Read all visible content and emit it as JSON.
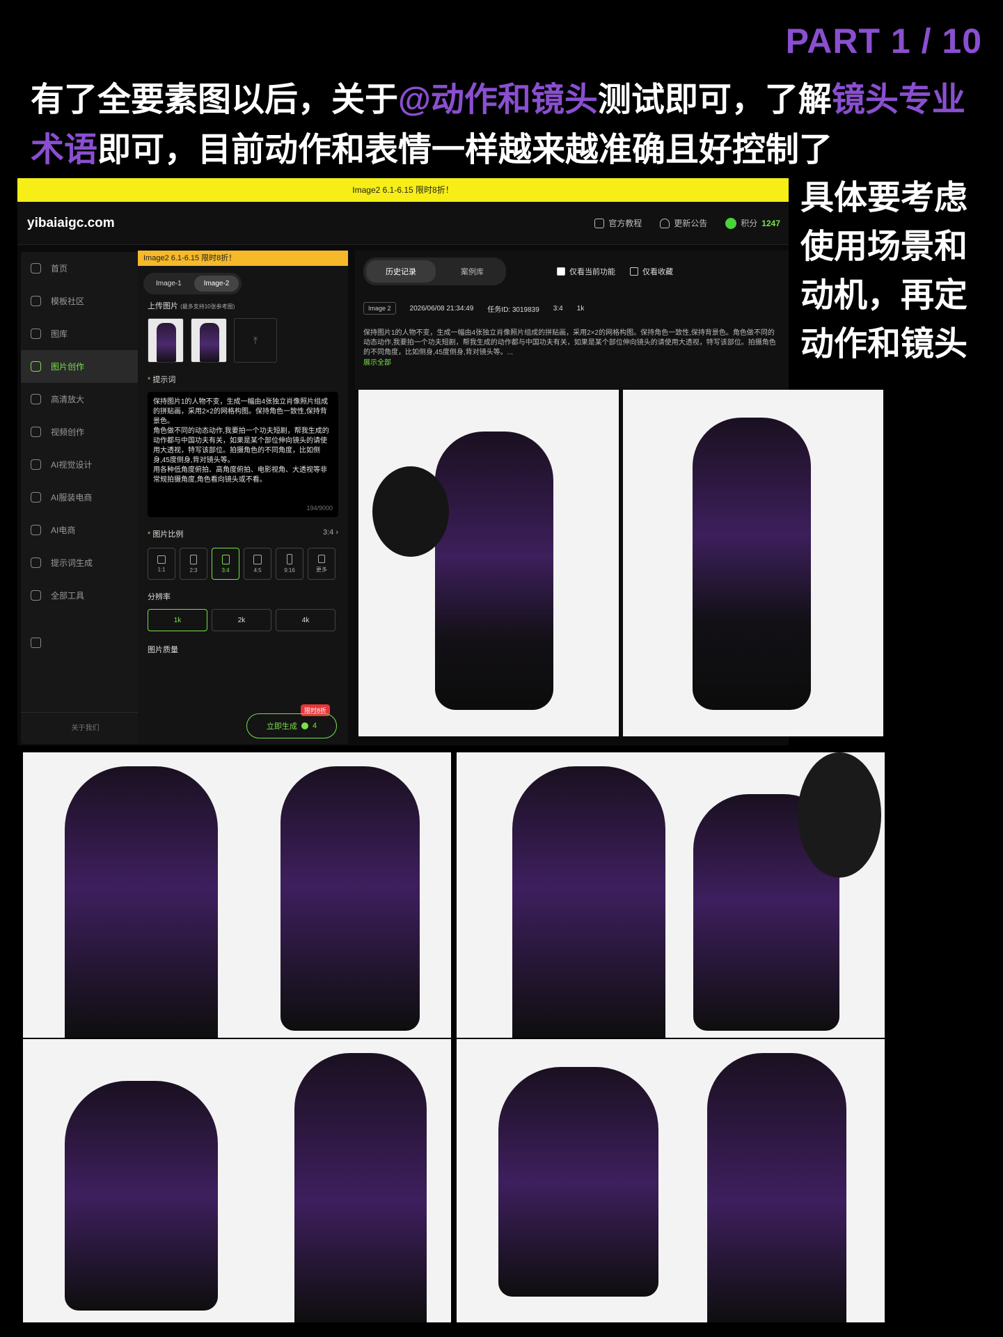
{
  "part_label": "PART 1 / 10",
  "headline": {
    "seg1": "有了全要素图以后，关于",
    "seg2": "@动作和镜头",
    "seg3": "测试即可，了解",
    "seg4": "镜头专业术语",
    "seg5": "即可，目前动作和表情一样越来越准确且好控制了"
  },
  "side_note": "具体要考虑使用场景和动机，再定动作和镜头",
  "colors": {
    "accent_purple": "#8a4fd0",
    "accent_green": "#7be04a",
    "promo_yellow": "#f6ee16"
  },
  "app": {
    "promo": "Image2 6.1-6.15 限时8折！",
    "logo": "yibaiaigc.com",
    "nav": {
      "tutorial": "官方教程",
      "announcement": "更新公告",
      "points_label": "积分",
      "points_value": "1247"
    },
    "sidebar": {
      "items": [
        {
          "label": "首页",
          "icon": "home-icon"
        },
        {
          "label": "模板社区",
          "icon": "community-icon"
        },
        {
          "label": "图库",
          "icon": "gallery-icon"
        },
        {
          "label": "图片创作",
          "icon": "image-create-icon"
        },
        {
          "label": "高清放大",
          "icon": "upscale-icon"
        },
        {
          "label": "视频创作",
          "icon": "video-icon"
        },
        {
          "label": "AI视觉设计",
          "icon": "design-icon"
        },
        {
          "label": "AI服装电商",
          "icon": "apparel-icon"
        },
        {
          "label": "AI电商",
          "icon": "ecommerce-icon"
        },
        {
          "label": "提示词生成",
          "icon": "prompt-icon"
        },
        {
          "label": "全部工具",
          "icon": "tools-icon"
        }
      ],
      "active_index": 3,
      "footer": "关于我们"
    },
    "panel": {
      "promo": "Image2 6.1-6.15 限时8折！",
      "model_tabs": [
        "Image-1",
        "Image-2"
      ],
      "active_model": 1,
      "upload_label": "上传图片",
      "upload_hint": "(最多支持10张参考图)",
      "upload_icon": "upload-icon",
      "prompt_label": "提示词",
      "prompt_text": "保持图片1的人物不变，生成一幅由4张独立肖像照片组成的拼贴画，采用2×2的网格构图。保持角色一致性,保持背景色。\n角色做不同的动态动作,我要拍一个功夫短剧，帮我生成的动作都与中国功夫有关，如果是某个部位伸向镜头的请使用大透视，特写该部位。拍摄角色的不同角度，比如侧身,45度侧身,背对镜头等。\n用各种低角度俯拍、高角度俯拍、电影视角、大透视等非常规拍摄角度,角色看向镜头或不看。",
      "prompt_count": "194/9000",
      "ratio_label": "图片比例",
      "ratio_value": "3:4",
      "ratios": [
        "1:1",
        "2:3",
        "3:4",
        "4:5",
        "9:16",
        "更多"
      ],
      "active_ratio": 2,
      "resolution_label": "分辨率",
      "resolutions": [
        "1k",
        "2k",
        "4k"
      ],
      "active_resolution": 0,
      "quality_label": "图片质量",
      "generate_tag": "限时8折",
      "generate_label": "立即生成",
      "generate_cost": "4"
    },
    "history": {
      "tabs": [
        "历史记录",
        "案例库"
      ],
      "active_tab": 0,
      "filter1": "仅看当前功能",
      "filter2": "仅看收藏",
      "model_badge": "Image 2",
      "timestamp": "2026/06/08 21:34:49",
      "task_id": "任务ID: 3019839",
      "ratio": "3:4",
      "resolution": "1k",
      "description": "保持图片1的人物不变，生成一幅由4张独立肖像照片组成的拼贴画，采用2×2的网格构图。保持角色一致性,保持背景色。角色做不同的动态动作,我要拍一个功夫短剧，帮我生成的动作都与中国功夫有关，如果是某个部位伸向镜头的请使用大透视，特写该部位。拍摄角色的不同角度，比如侧身,45度侧身,背对镜头等。...",
      "expand": "展示全部"
    }
  }
}
